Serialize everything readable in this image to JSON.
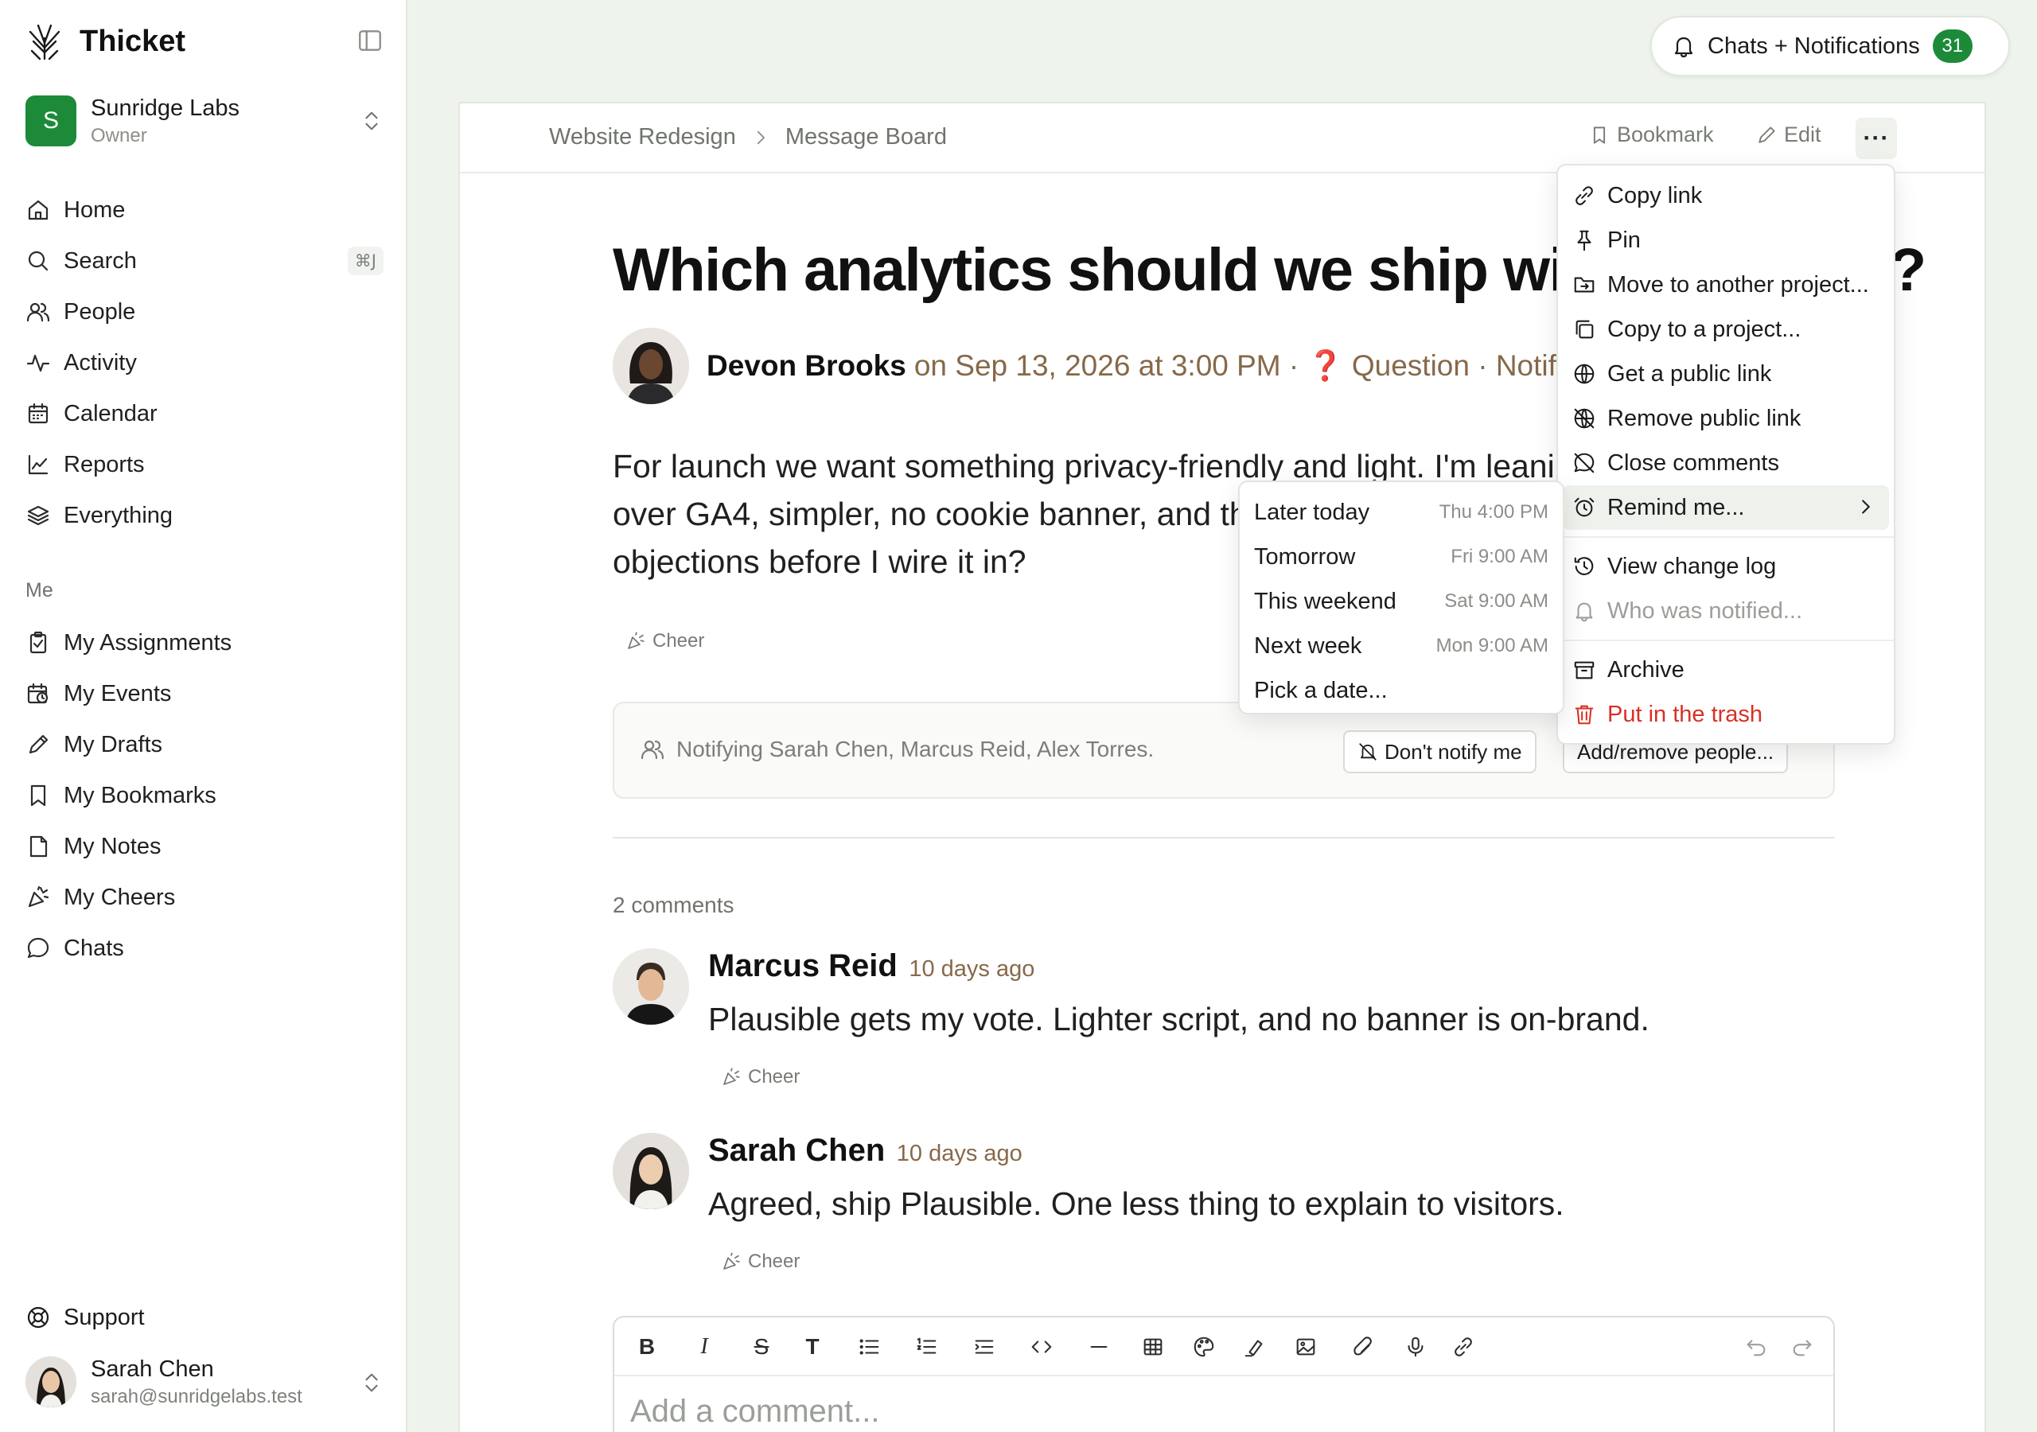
{
  "app": {
    "name": "Thicket"
  },
  "org": {
    "name": "Sunridge Labs",
    "role": "Owner",
    "initial": "S"
  },
  "nav": {
    "home": "Home",
    "search": "Search",
    "search_shortcut": "⌘J",
    "people": "People",
    "activity": "Activity",
    "calendar": "Calendar",
    "reports": "Reports",
    "everything": "Everything"
  },
  "me": {
    "label": "Me",
    "assignments": "My Assignments",
    "events": "My Events",
    "drafts": "My Drafts",
    "bookmarks": "My Bookmarks",
    "notes": "My Notes",
    "cheers": "My Cheers",
    "chats": "Chats"
  },
  "support": "Support",
  "user": {
    "name": "Sarah Chen",
    "email": "sarah@sunridgelabs.test"
  },
  "notifications": {
    "label": "Chats + Notifications",
    "count": "31"
  },
  "breadcrumb": {
    "project": "Website Redesign",
    "section": "Message Board"
  },
  "header_actions": {
    "bookmark": "Bookmark",
    "edit": "Edit",
    "more": "···"
  },
  "post": {
    "title": "Which analytics should we ship with at launch?",
    "author": "Devon Brooks",
    "meta": "on Sep 13, 2026 at 3:00 PM · ❓ Question · Notified 3 people",
    "body": "For launch we want something privacy-friendly and light. I'm leaning Plausible over GA4, simpler, no cookie banner, and the dashboard is easy to share. Any objections before I wire it in?",
    "cheer": "Cheer"
  },
  "notify": {
    "text": "Notifying Sarah Chen, Marcus Reid, Alex Torres.",
    "dont_notify": "Don't notify me",
    "add_remove": "Add/remove people..."
  },
  "comments": {
    "count_label": "2 comments",
    "items": [
      {
        "author": "Marcus Reid",
        "time": "10 days ago",
        "body": "Plausible gets my vote. Lighter script, and no banner is on-brand.",
        "cheer": "Cheer"
      },
      {
        "author": "Sarah Chen",
        "time": "10 days ago",
        "body": "Agreed, ship Plausible. One less thing to explain to visitors.",
        "cheer": "Cheer"
      }
    ]
  },
  "editor": {
    "placeholder": "Add a comment..."
  },
  "menu": {
    "copy_link": "Copy link",
    "pin": "Pin",
    "move": "Move to another project...",
    "copy_to": "Copy to a project...",
    "public_link": "Get a public link",
    "remove_public": "Remove public link",
    "close_comments": "Close comments",
    "remind": "Remind me...",
    "change_log": "View change log",
    "who_notified": "Who was notified...",
    "archive": "Archive",
    "trash": "Put in the trash"
  },
  "remind_menu": [
    {
      "label": "Later today",
      "when": "Thu 4:00 PM"
    },
    {
      "label": "Tomorrow",
      "when": "Fri 9:00 AM"
    },
    {
      "label": "This weekend",
      "when": "Sat 9:00 AM"
    },
    {
      "label": "Next week",
      "when": "Mon 9:00 AM"
    },
    {
      "label": "Pick a date...",
      "when": ""
    }
  ],
  "colors": {
    "accent": "#1d8a3a",
    "meta_brown": "#86694a",
    "danger": "#d93025",
    "page_bg": "#eef3ec"
  }
}
